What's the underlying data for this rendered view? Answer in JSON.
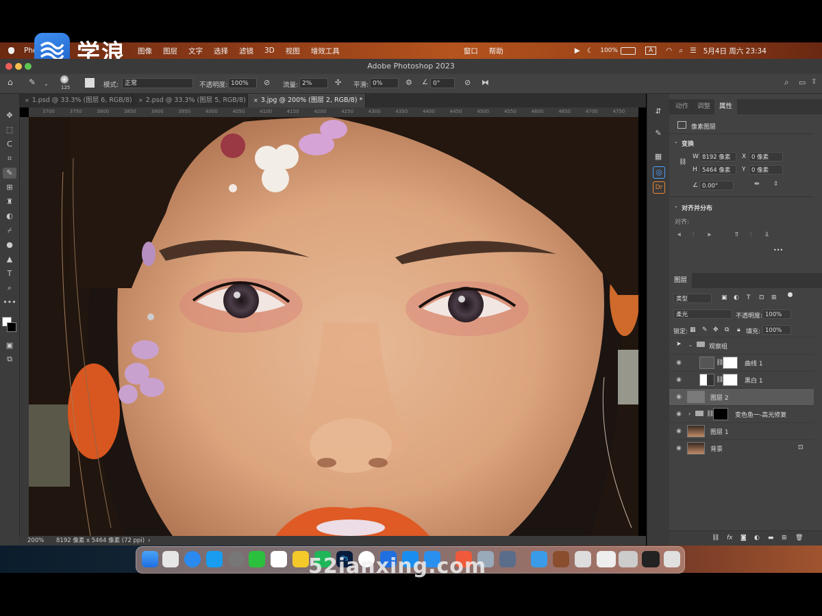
{
  "menubar": {
    "apple": "",
    "app": "Photo",
    "items": [
      "图像",
      "图层",
      "文字",
      "选择",
      "滤镜",
      "3D",
      "视图",
      "增效工具"
    ],
    "right_items": [
      "窗口",
      "帮助"
    ],
    "battery": "100%",
    "input_method": "A",
    "datetime": "5月4日 周六 23:34"
  },
  "logo": {
    "text": "学浪"
  },
  "titlebar": {
    "title": "Adobe Photoshop 2023"
  },
  "options": {
    "brush_size": "125",
    "mode_label": "模式:",
    "mode_value": "正常",
    "opacity_label": "不透明度:",
    "opacity_value": "100%",
    "flow_label": "流量:",
    "flow_value": "2%",
    "smooth_label": "平滑:",
    "smooth_value": "0%",
    "angle_value": "0°"
  },
  "tabs": [
    {
      "label": "1.psd @ 33.3% (图层 6, RGB/8)"
    },
    {
      "label": "2.psd @ 33.3% (图层 5, RGB/8)"
    },
    {
      "label": "3.jpg @ 200% (图层 2, RGB/8) *"
    }
  ],
  "ruler": {
    "ticks": [
      "3700",
      "3750",
      "3800",
      "3850",
      "3900",
      "3950",
      "4000",
      "4050",
      "4100",
      "4150",
      "4200",
      "4250",
      "4300",
      "4350",
      "4400",
      "4450",
      "4500",
      "4550",
      "4600",
      "4650",
      "4700",
      "4750"
    ]
  },
  "status": {
    "zoom": "200%",
    "doc_info": "8192 像素 x 5464 像素 (72 ppi)"
  },
  "properties": {
    "tabs": [
      "动作",
      "调整",
      "属性"
    ],
    "layer_type": "像素图层",
    "transform_title": "变换",
    "w_label": "W",
    "w_value": "8192 像素",
    "h_label": "H",
    "h_value": "5464 像素",
    "x_label": "X",
    "x_value": "0 像素",
    "y_label": "Y",
    "y_value": "0 像素",
    "angle": "0.00°",
    "align_title": "对齐并分布",
    "align_label": "对齐:",
    "more": "•••"
  },
  "layers": {
    "tab": "图层",
    "filter_kind": "类型",
    "blend_mode": "柔光",
    "opacity_label": "不透明度:",
    "opacity_value": "100%",
    "lock_label": "锁定:",
    "fill_label": "填充:",
    "fill_value": "100%",
    "rows": [
      {
        "name": "观察组"
      },
      {
        "name": "曲线 1"
      },
      {
        "name": "黑白 1"
      },
      {
        "name": "图层 2"
      },
      {
        "name": "变色鱼一-高光修复"
      },
      {
        "name": "图层 1"
      },
      {
        "name": "背景"
      }
    ]
  },
  "watermark": "52ianxing.com",
  "colors": {
    "accent": "#1f6fe0",
    "menubar_orange": "#b5541e",
    "panel_bg": "#424242"
  }
}
